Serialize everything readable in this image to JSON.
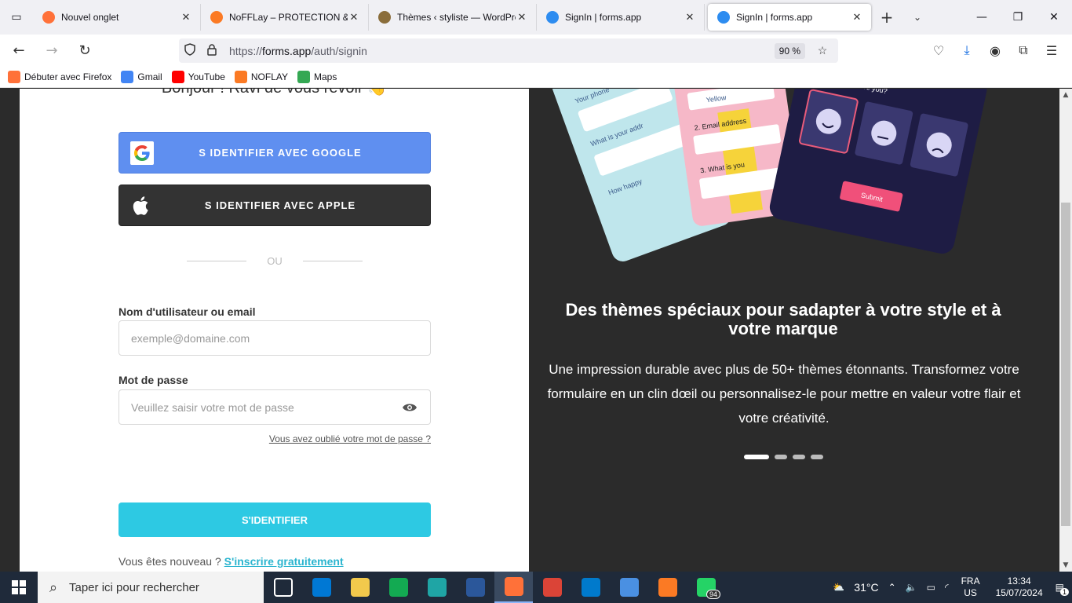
{
  "browser": {
    "tabs": [
      {
        "title": "Nouvel onglet",
        "icon": "firefox-icon",
        "color": "#ff7139",
        "active": false
      },
      {
        "title": "NoFFLay – PROTECTION & BE",
        "icon": "xampp-icon",
        "color": "#fb7a24",
        "active": false
      },
      {
        "title": "Thèmes ‹ styliste — WordPres",
        "icon": "wordpress-icon",
        "color": "#8a6d3b",
        "active": false
      },
      {
        "title": "SignIn | forms.app",
        "icon": "forms-app-icon",
        "color": "#2d8cf0",
        "active": false
      },
      {
        "title": "SignIn | forms.app",
        "icon": "forms-app-icon",
        "color": "#2d8cf0",
        "active": true
      }
    ],
    "url_prefix": "https://",
    "url_domain": "forms.app",
    "url_path": "/auth/signin",
    "zoom": "90 %",
    "bookmarks": [
      {
        "label": "Débuter avec Firefox",
        "icon": "firefox-icon",
        "color": "#ff7139"
      },
      {
        "label": "Gmail",
        "icon": "google-icon",
        "color": "#4285f4"
      },
      {
        "label": "YouTube",
        "icon": "youtube-icon",
        "color": "#ff0000"
      },
      {
        "label": "NOFLAY",
        "icon": "xampp-icon",
        "color": "#fb7a24"
      },
      {
        "label": "Maps",
        "icon": "maps-pin-icon",
        "color": "#34a853"
      }
    ]
  },
  "signin": {
    "greeting": "Bonjour ! Ravi de vous revoir 👋",
    "google_label": "S IDENTIFIER AVEC GOOGLE",
    "apple_label": "S IDENTIFIER AVEC APPLE",
    "or_label": "OU",
    "username_label": "Nom d'utilisateur ou email",
    "username_placeholder": "exemple@domaine.com",
    "password_label": "Mot de passe",
    "password_placeholder": "Veuillez saisir votre mot de passe",
    "forgot_label": "Vous avez oublié votre mot de passe ?",
    "submit_label": "S'IDENTIFIER",
    "new_user_text": "Vous êtes nouveau ?",
    "signup_label": "S'inscrire gratuitement"
  },
  "promo": {
    "mock_labels": {
      "q1": "Your phone",
      "q2": "What is your addr",
      "q3": "How happy",
      "yellow": "Yellow",
      "email": "2. Email address",
      "what": "3. What is you",
      "satisfied": "How satisfied are you?",
      "submit": "Submit"
    },
    "title": "Des thèmes spéciaux pour sadapter à votre style et à votre marque",
    "text": "Une impression durable avec plus de 50+ thèmes étonnants. Transformez votre formulaire en un clin dœil ou personnalisez-le pour mettre en valeur votre flair et votre créativité.",
    "slides": 4,
    "active_slide": 1
  },
  "taskbar": {
    "search_placeholder": "Taper ici pour rechercher",
    "apps": [
      {
        "name": "task-view-icon",
        "color": "#1f2a3a"
      },
      {
        "name": "microsoft-store-icon",
        "color": "#0078d4"
      },
      {
        "name": "file-explorer-icon",
        "color": "#f2c94c"
      },
      {
        "name": "mongodb-compass-icon",
        "color": "#13aa52"
      },
      {
        "name": "edge-icon",
        "color": "#1fa5a5"
      },
      {
        "name": "word-icon",
        "color": "#2b579a"
      },
      {
        "name": "firefox-icon",
        "color": "#ff7139"
      },
      {
        "name": "chrome-icon",
        "color": "#db4437"
      },
      {
        "name": "vscode-icon",
        "color": "#007acc"
      },
      {
        "name": "app-icon",
        "color": "#4a90e2"
      },
      {
        "name": "xampp-icon",
        "color": "#fb7a24"
      },
      {
        "name": "whatsapp-icon",
        "color": "#25d366"
      }
    ],
    "whatsapp_badge": "94",
    "weather": "31°C",
    "lang_top": "FRA",
    "lang_bottom": "US",
    "time": "13:34",
    "date": "15/07/2024",
    "notifications": "1"
  }
}
